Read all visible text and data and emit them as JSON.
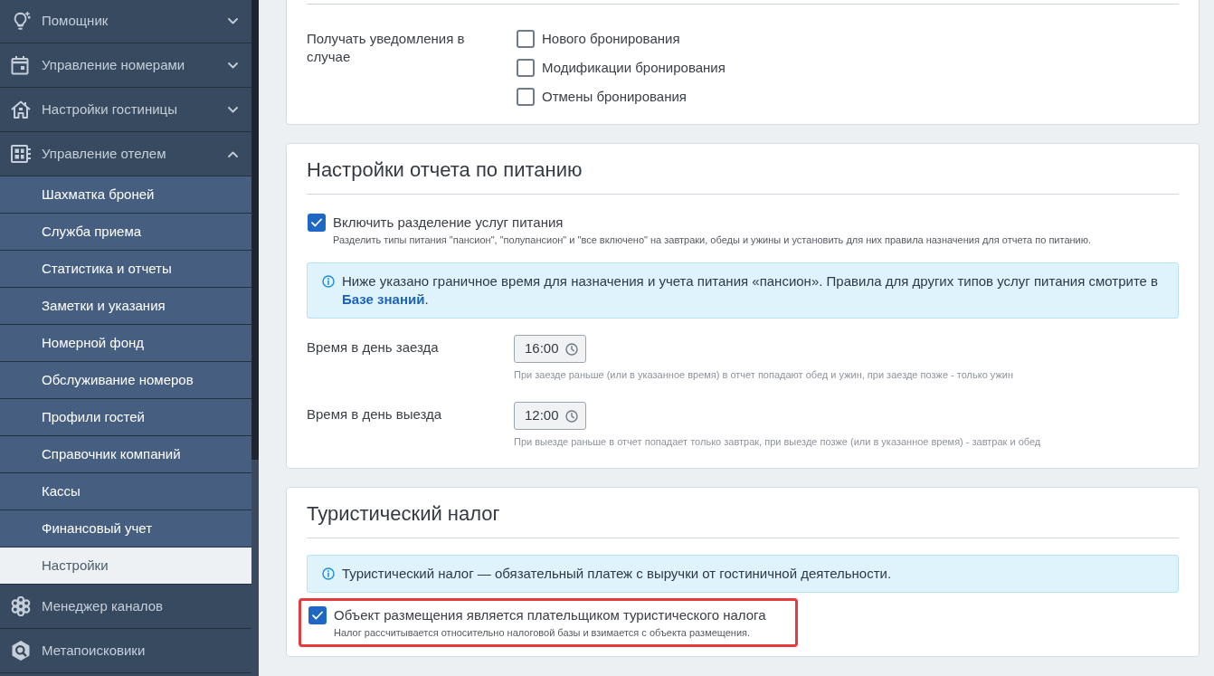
{
  "sidebar": {
    "items": [
      {
        "label": "Помощник",
        "expanded": false
      },
      {
        "label": "Управление номерами",
        "expanded": false
      },
      {
        "label": "Настройки гостиницы",
        "expanded": false
      },
      {
        "label": "Управление отелем",
        "expanded": true,
        "children": [
          {
            "label": "Шахматка броней",
            "selected": false
          },
          {
            "label": "Служба приема",
            "selected": false
          },
          {
            "label": "Статистика и отчеты",
            "selected": false
          },
          {
            "label": "Заметки и указания",
            "selected": false
          },
          {
            "label": "Номерной фонд",
            "selected": false
          },
          {
            "label": "Обслуживание номеров",
            "selected": false
          },
          {
            "label": "Профили гостей",
            "selected": false
          },
          {
            "label": "Справочник компаний",
            "selected": false
          },
          {
            "label": "Кассы",
            "selected": false
          },
          {
            "label": "Финансовый учет",
            "selected": false
          },
          {
            "label": "Настройки",
            "selected": true
          }
        ]
      },
      {
        "label": "Менеджер каналов"
      },
      {
        "label": "Метапоисковики"
      }
    ]
  },
  "notifications": {
    "label": "Получать уведомления в случае",
    "options": [
      {
        "label": "Нового бронирования",
        "checked": false
      },
      {
        "label": "Модификации бронирования",
        "checked": false
      },
      {
        "label": "Отмены бронирования",
        "checked": false
      }
    ]
  },
  "meal_report": {
    "title": "Настройки отчета по питанию",
    "split": {
      "label": "Включить разделение услуг питания",
      "hint": "Разделить типы питания \"пансион\", \"полупансион\" и \"все включено\" на завтраки, обеды и ужины и установить для них правила назначения для отчета по питанию.",
      "checked": true
    },
    "info": {
      "text": "Ниже указано граничное время для назначения и учета питания «пансион». Правила для других типов услуг питания смотрите в",
      "link": "Базе знаний",
      "text_end": "."
    },
    "times": [
      {
        "label": "Время в день заезда",
        "value": "16:00",
        "hint": "При заезде раньше (или в указанное время) в отчет попадают обед и ужин, при заезде позже - только ужин"
      },
      {
        "label": "Время в день выезда",
        "value": "12:00",
        "hint": "При выезде раньше в отчет попадает только завтрак, при выезде позже (или в указанное время) - завтрак и обед"
      }
    ]
  },
  "tourist_tax": {
    "title": "Туристический налог",
    "info": "Туристический налог — обязательный платеж с выручки от гостиничной деятельности.",
    "payer": {
      "label": "Объект размещения является плательщиком туристического налога",
      "hint": "Налог рассчитывается относительно налоговой базы и взимается с объекта размещения.",
      "checked": true,
      "highlighted": true
    }
  }
}
